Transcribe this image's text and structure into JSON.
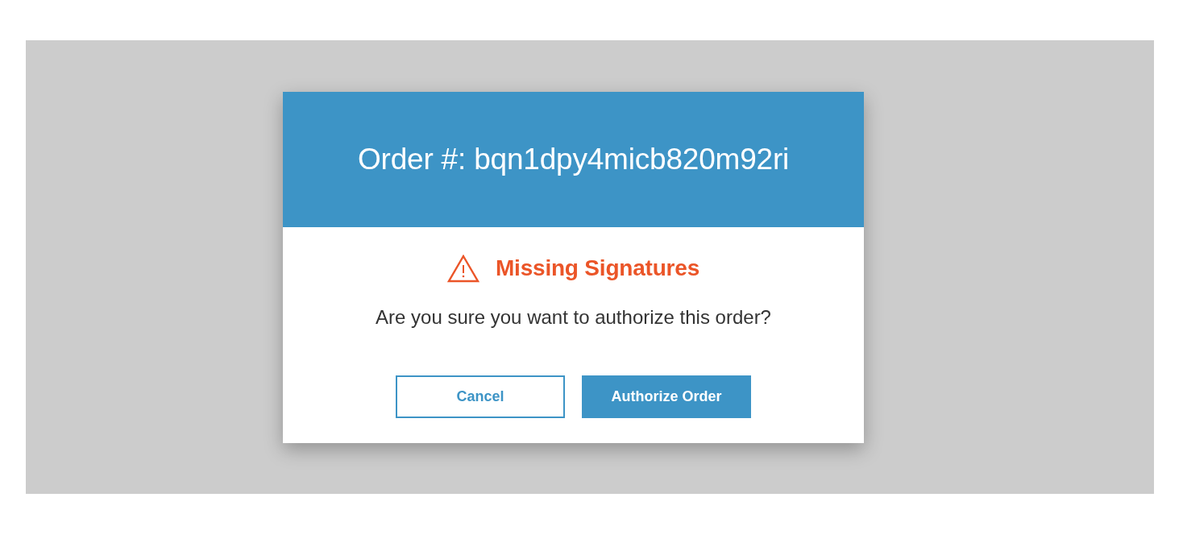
{
  "dialog": {
    "title": "Order #: bqn1dpy4micb820m92ri",
    "alert": {
      "kind": "warning",
      "text": "Missing Signatures"
    },
    "message": "Are you sure you want to authorize this order?",
    "buttons": [
      {
        "label": "Cancel",
        "kind": "secondary"
      },
      {
        "label": "Authorize Order",
        "kind": "primary"
      }
    ]
  }
}
